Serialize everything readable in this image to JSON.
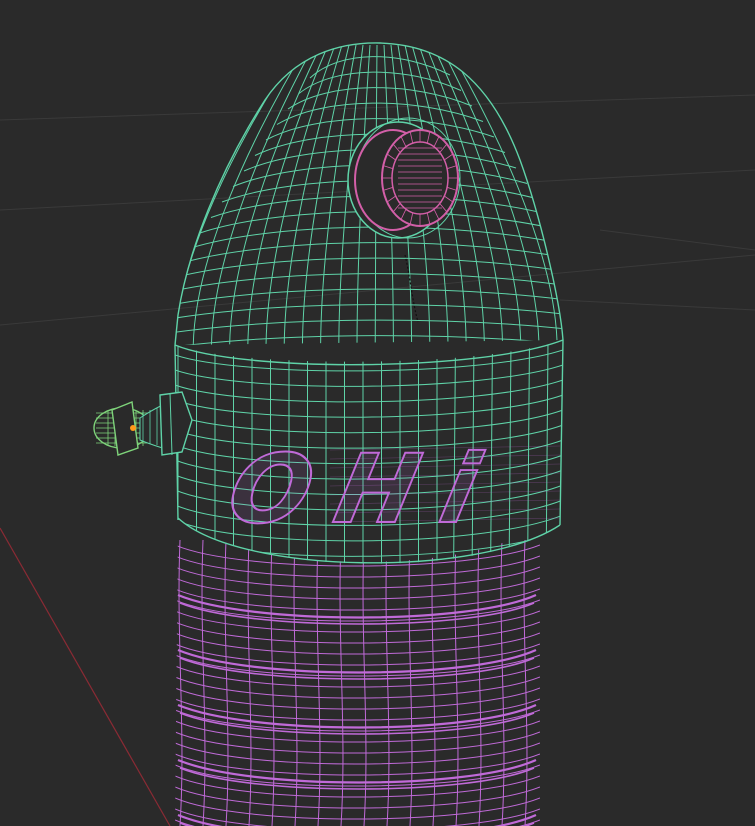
{
  "viewport": {
    "background": "#2a2a2a",
    "grid_color": "#3a3a3a",
    "x_axis_color": "#8a2a34"
  },
  "model": {
    "body_color": "#5fd3a8",
    "spring_color": "#c06ad8",
    "eyelet_color": "#d35fa8",
    "valve_color": "#7ed37a",
    "origin_color": "#ff9a1a",
    "logo_text": "OHi"
  }
}
